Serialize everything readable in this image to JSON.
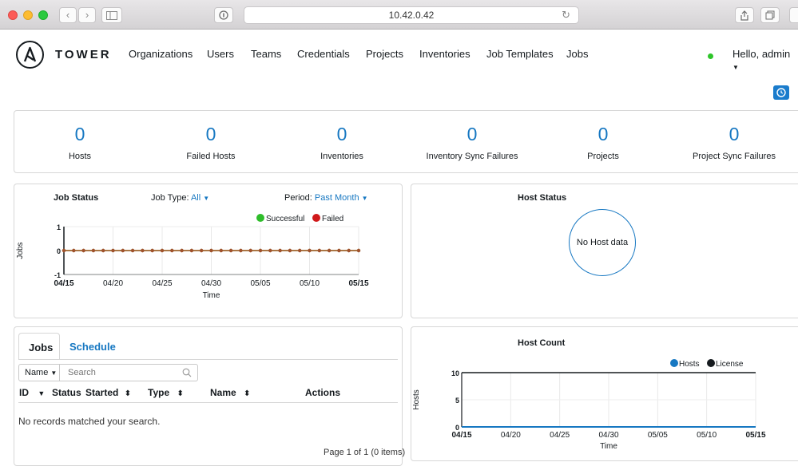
{
  "browser": {
    "url": "10.42.0.42"
  },
  "app": {
    "brand": "TOWER",
    "nav": [
      "Organizations",
      "Users",
      "Teams",
      "Credentials",
      "Projects",
      "Inventories",
      "Job Templates",
      "Jobs"
    ],
    "user_greeting": "Hello, admin",
    "status_color": "#2ec52a"
  },
  "counts": [
    {
      "value": "0",
      "label": "Hosts"
    },
    {
      "value": "0",
      "label": "Failed Hosts"
    },
    {
      "value": "0",
      "label": "Inventories"
    },
    {
      "value": "0",
      "label": "Inventory Sync Failures"
    },
    {
      "value": "0",
      "label": "Projects"
    },
    {
      "value": "0",
      "label": "Project Sync Failures"
    }
  ],
  "job_status": {
    "title": "Job Status",
    "job_type_label": "Job Type:",
    "job_type_value": "All",
    "period_label": "Period:",
    "period_value": "Past Month",
    "legend": [
      {
        "name": "Successful",
        "color": "#2ebd2a"
      },
      {
        "name": "Failed",
        "color": "#d0191a"
      }
    ],
    "ylabel": "Jobs",
    "xlabel": "Time",
    "yticks": [
      "1",
      "0",
      "-1"
    ],
    "xticks": [
      "04/15",
      "04/20",
      "04/25",
      "04/30",
      "05/05",
      "05/10",
      "05/15"
    ]
  },
  "host_status": {
    "title": "Host Status",
    "empty_text": "No Host data"
  },
  "jobs_panel": {
    "tabs": [
      "Jobs",
      "Schedule"
    ],
    "filter_field": "Name",
    "search_placeholder": "Search",
    "columns": [
      "ID",
      "Status",
      "Started",
      "Type",
      "Name",
      "Actions"
    ],
    "empty_text": "No records matched your search.",
    "pagination": "Page 1 of 1 (0 items)"
  },
  "host_count": {
    "title": "Host Count",
    "legend": [
      {
        "name": "Hosts",
        "color": "#1778c2"
      },
      {
        "name": "License",
        "color": "#161b1f"
      }
    ],
    "ylabel": "Hosts",
    "xlabel": "Time",
    "yticks": [
      "10",
      "5",
      "0"
    ],
    "xticks": [
      "04/15",
      "04/20",
      "04/25",
      "04/30",
      "05/05",
      "05/10",
      "05/15"
    ]
  },
  "chart_data": [
    {
      "type": "line",
      "title": "Job Status",
      "xlabel": "Time",
      "ylabel": "Jobs",
      "ylim": [
        -1,
        1
      ],
      "x": [
        "04/15",
        "04/16",
        "04/17",
        "04/18",
        "04/19",
        "04/20",
        "04/21",
        "04/22",
        "04/23",
        "04/24",
        "04/25",
        "04/26",
        "04/27",
        "04/28",
        "04/29",
        "04/30",
        "05/01",
        "05/02",
        "05/03",
        "05/04",
        "05/05",
        "05/06",
        "05/07",
        "05/08",
        "05/09",
        "05/10",
        "05/11",
        "05/12",
        "05/13",
        "05/14",
        "05/15"
      ],
      "series": [
        {
          "name": "Successful",
          "values": [
            0,
            0,
            0,
            0,
            0,
            0,
            0,
            0,
            0,
            0,
            0,
            0,
            0,
            0,
            0,
            0,
            0,
            0,
            0,
            0,
            0,
            0,
            0,
            0,
            0,
            0,
            0,
            0,
            0,
            0,
            0
          ]
        },
        {
          "name": "Failed",
          "values": [
            0,
            0,
            0,
            0,
            0,
            0,
            0,
            0,
            0,
            0,
            0,
            0,
            0,
            0,
            0,
            0,
            0,
            0,
            0,
            0,
            0,
            0,
            0,
            0,
            0,
            0,
            0,
            0,
            0,
            0,
            0
          ]
        }
      ],
      "grid": true,
      "legend": "top-right"
    },
    {
      "type": "line",
      "title": "Host Count",
      "xlabel": "Time",
      "ylabel": "Hosts",
      "ylim": [
        0,
        10
      ],
      "x": [
        "04/15",
        "05/15"
      ],
      "series": [
        {
          "name": "Hosts",
          "values": [
            0,
            0
          ]
        },
        {
          "name": "License",
          "values": [
            10,
            10
          ]
        }
      ],
      "grid": true,
      "legend": "top-right"
    }
  ]
}
